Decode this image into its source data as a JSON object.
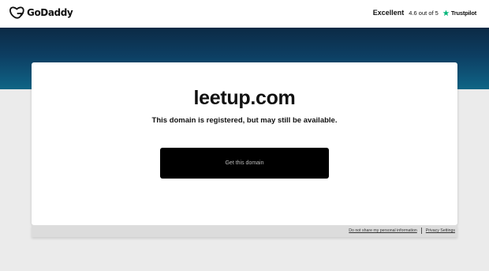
{
  "header": {
    "logo_text": "GoDaddy",
    "logo_icon": "godaddy-logo-icon",
    "rating": {
      "label": "Excellent",
      "score": "4.6 out of 5",
      "provider": "Trustpilot",
      "provider_icon": "star-icon",
      "star_color": "#00b67a"
    }
  },
  "main": {
    "domain": "leetup.com",
    "status": "This domain is registered, but may still be available.",
    "cta_label": "Get this domain"
  },
  "footer": {
    "links": [
      "Do not share my personal information",
      "Privacy Settings"
    ]
  },
  "colors": {
    "banner_top": "#0b2a45",
    "banner_bottom": "#0f6585",
    "cta_bg": "#000000",
    "page_bg": "#ebebeb"
  }
}
